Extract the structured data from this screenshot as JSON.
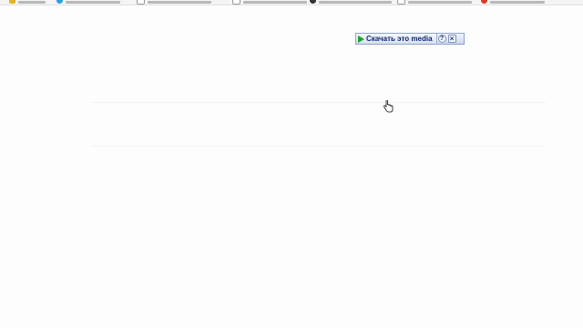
{
  "bookmarks": [
    {
      "icon": "folder-icon",
      "color": "#e6b422"
    },
    {
      "icon": "site-icon",
      "color": "#2e9fd8"
    },
    {
      "icon": "page-icon",
      "color": "#9a9a9a"
    },
    {
      "icon": "page-icon",
      "color": "#9a9a9a"
    },
    {
      "icon": "site-icon",
      "color": "#333333"
    },
    {
      "icon": "page-icon",
      "color": "#9a9a9a"
    },
    {
      "icon": "site-icon",
      "color": "#d93a2b"
    }
  ],
  "media_toolbar": {
    "download_label": "Скачать это media",
    "help_glyph": "?",
    "close_glyph": "×"
  },
  "colors": {
    "page_background": "#fdfdfd",
    "toolbar_border": "#8ea4c8",
    "play_green": "#19a32a",
    "label_blue": "#0c2a6b"
  }
}
